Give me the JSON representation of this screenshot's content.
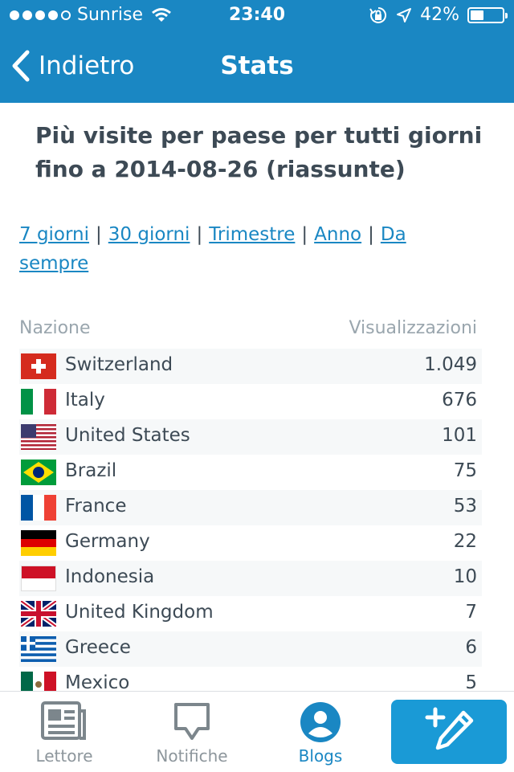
{
  "status_bar": {
    "carrier": "Sunrise",
    "time": "23:40",
    "battery": "42%"
  },
  "nav": {
    "back_label": "Indietro",
    "title": "Stats"
  },
  "page": {
    "title": "Più visite per paese per tutti giorni fino a 2014-08-26 (riassunte)",
    "periods": [
      "7 giorni",
      "30 giorni",
      "Trimestre",
      "Anno",
      "Da sempre"
    ],
    "separator": "|"
  },
  "table": {
    "headers": {
      "country": "Nazione",
      "views": "Visualizzazioni"
    },
    "rows": [
      {
        "country": "Switzerland",
        "views": "1.049",
        "flag": "ch"
      },
      {
        "country": "Italy",
        "views": "676",
        "flag": "it"
      },
      {
        "country": "United States",
        "views": "101",
        "flag": "us"
      },
      {
        "country": "Brazil",
        "views": "75",
        "flag": "br"
      },
      {
        "country": "France",
        "views": "53",
        "flag": "fr"
      },
      {
        "country": "Germany",
        "views": "22",
        "flag": "de"
      },
      {
        "country": "Indonesia",
        "views": "10",
        "flag": "id"
      },
      {
        "country": "United Kingdom",
        "views": "7",
        "flag": "gb"
      },
      {
        "country": "Greece",
        "views": "6",
        "flag": "gr"
      },
      {
        "country": "Mexico",
        "views": "5",
        "flag": "mx"
      }
    ]
  },
  "tab_bar": {
    "tabs": [
      {
        "label": "Lettore",
        "icon": "reader-icon"
      },
      {
        "label": "Notifiche",
        "icon": "notifications-icon"
      },
      {
        "label": "Blogs",
        "icon": "blogs-icon",
        "active": true
      }
    ],
    "compose_icon": "new-post-icon"
  },
  "colors": {
    "accent": "#1a87c3",
    "compose": "#1a9ad6",
    "text": "#3d4a55",
    "muted": "#9aa6ae"
  }
}
